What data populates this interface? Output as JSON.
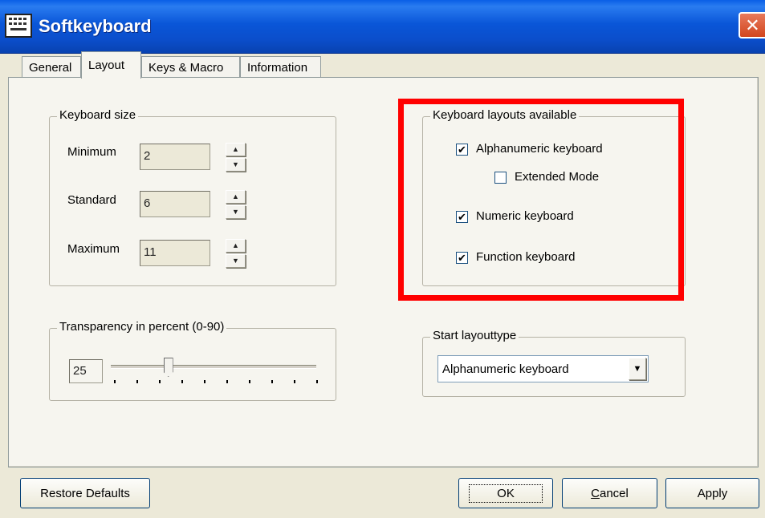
{
  "window": {
    "title": "Softkeyboard",
    "icon": "keyboard-icon",
    "close_glyph": "✕"
  },
  "tabs": [
    {
      "label": "General",
      "active": false
    },
    {
      "label": "Layout",
      "active": true
    },
    {
      "label": "Keys & Macro",
      "active": false
    },
    {
      "label": "Information",
      "active": false
    }
  ],
  "keyboard_size": {
    "legend": "Keyboard size",
    "rows": [
      {
        "label": "Minimum",
        "value": "2"
      },
      {
        "label": "Standard",
        "value": "6"
      },
      {
        "label": "Maximum",
        "value": "11"
      }
    ]
  },
  "transparency": {
    "legend": "Transparency in percent (0-90)",
    "value": "25",
    "slider_fraction": 0.28
  },
  "layouts_available": {
    "legend": "Keyboard layouts available",
    "items": [
      {
        "label": "Alphanumeric keyboard",
        "checked": true
      },
      {
        "label": "Extended Mode",
        "checked": false
      },
      {
        "label": "Numeric keyboard",
        "checked": true
      },
      {
        "label": "Function keyboard",
        "checked": true
      }
    ]
  },
  "start_layout": {
    "legend": "Start layouttype",
    "selected": "Alphanumeric keyboard"
  },
  "buttons": {
    "restore": "Restore Defaults",
    "ok": "OK",
    "cancel": "Cancel",
    "apply": "Apply"
  },
  "colors": {
    "highlight": "#ff0000",
    "titlebar": "#0a56d8",
    "face": "#ece9d8"
  },
  "check_glyph": "✔",
  "spin_up": "▲",
  "spin_down": "▼",
  "dropdown_glyph": "▼"
}
